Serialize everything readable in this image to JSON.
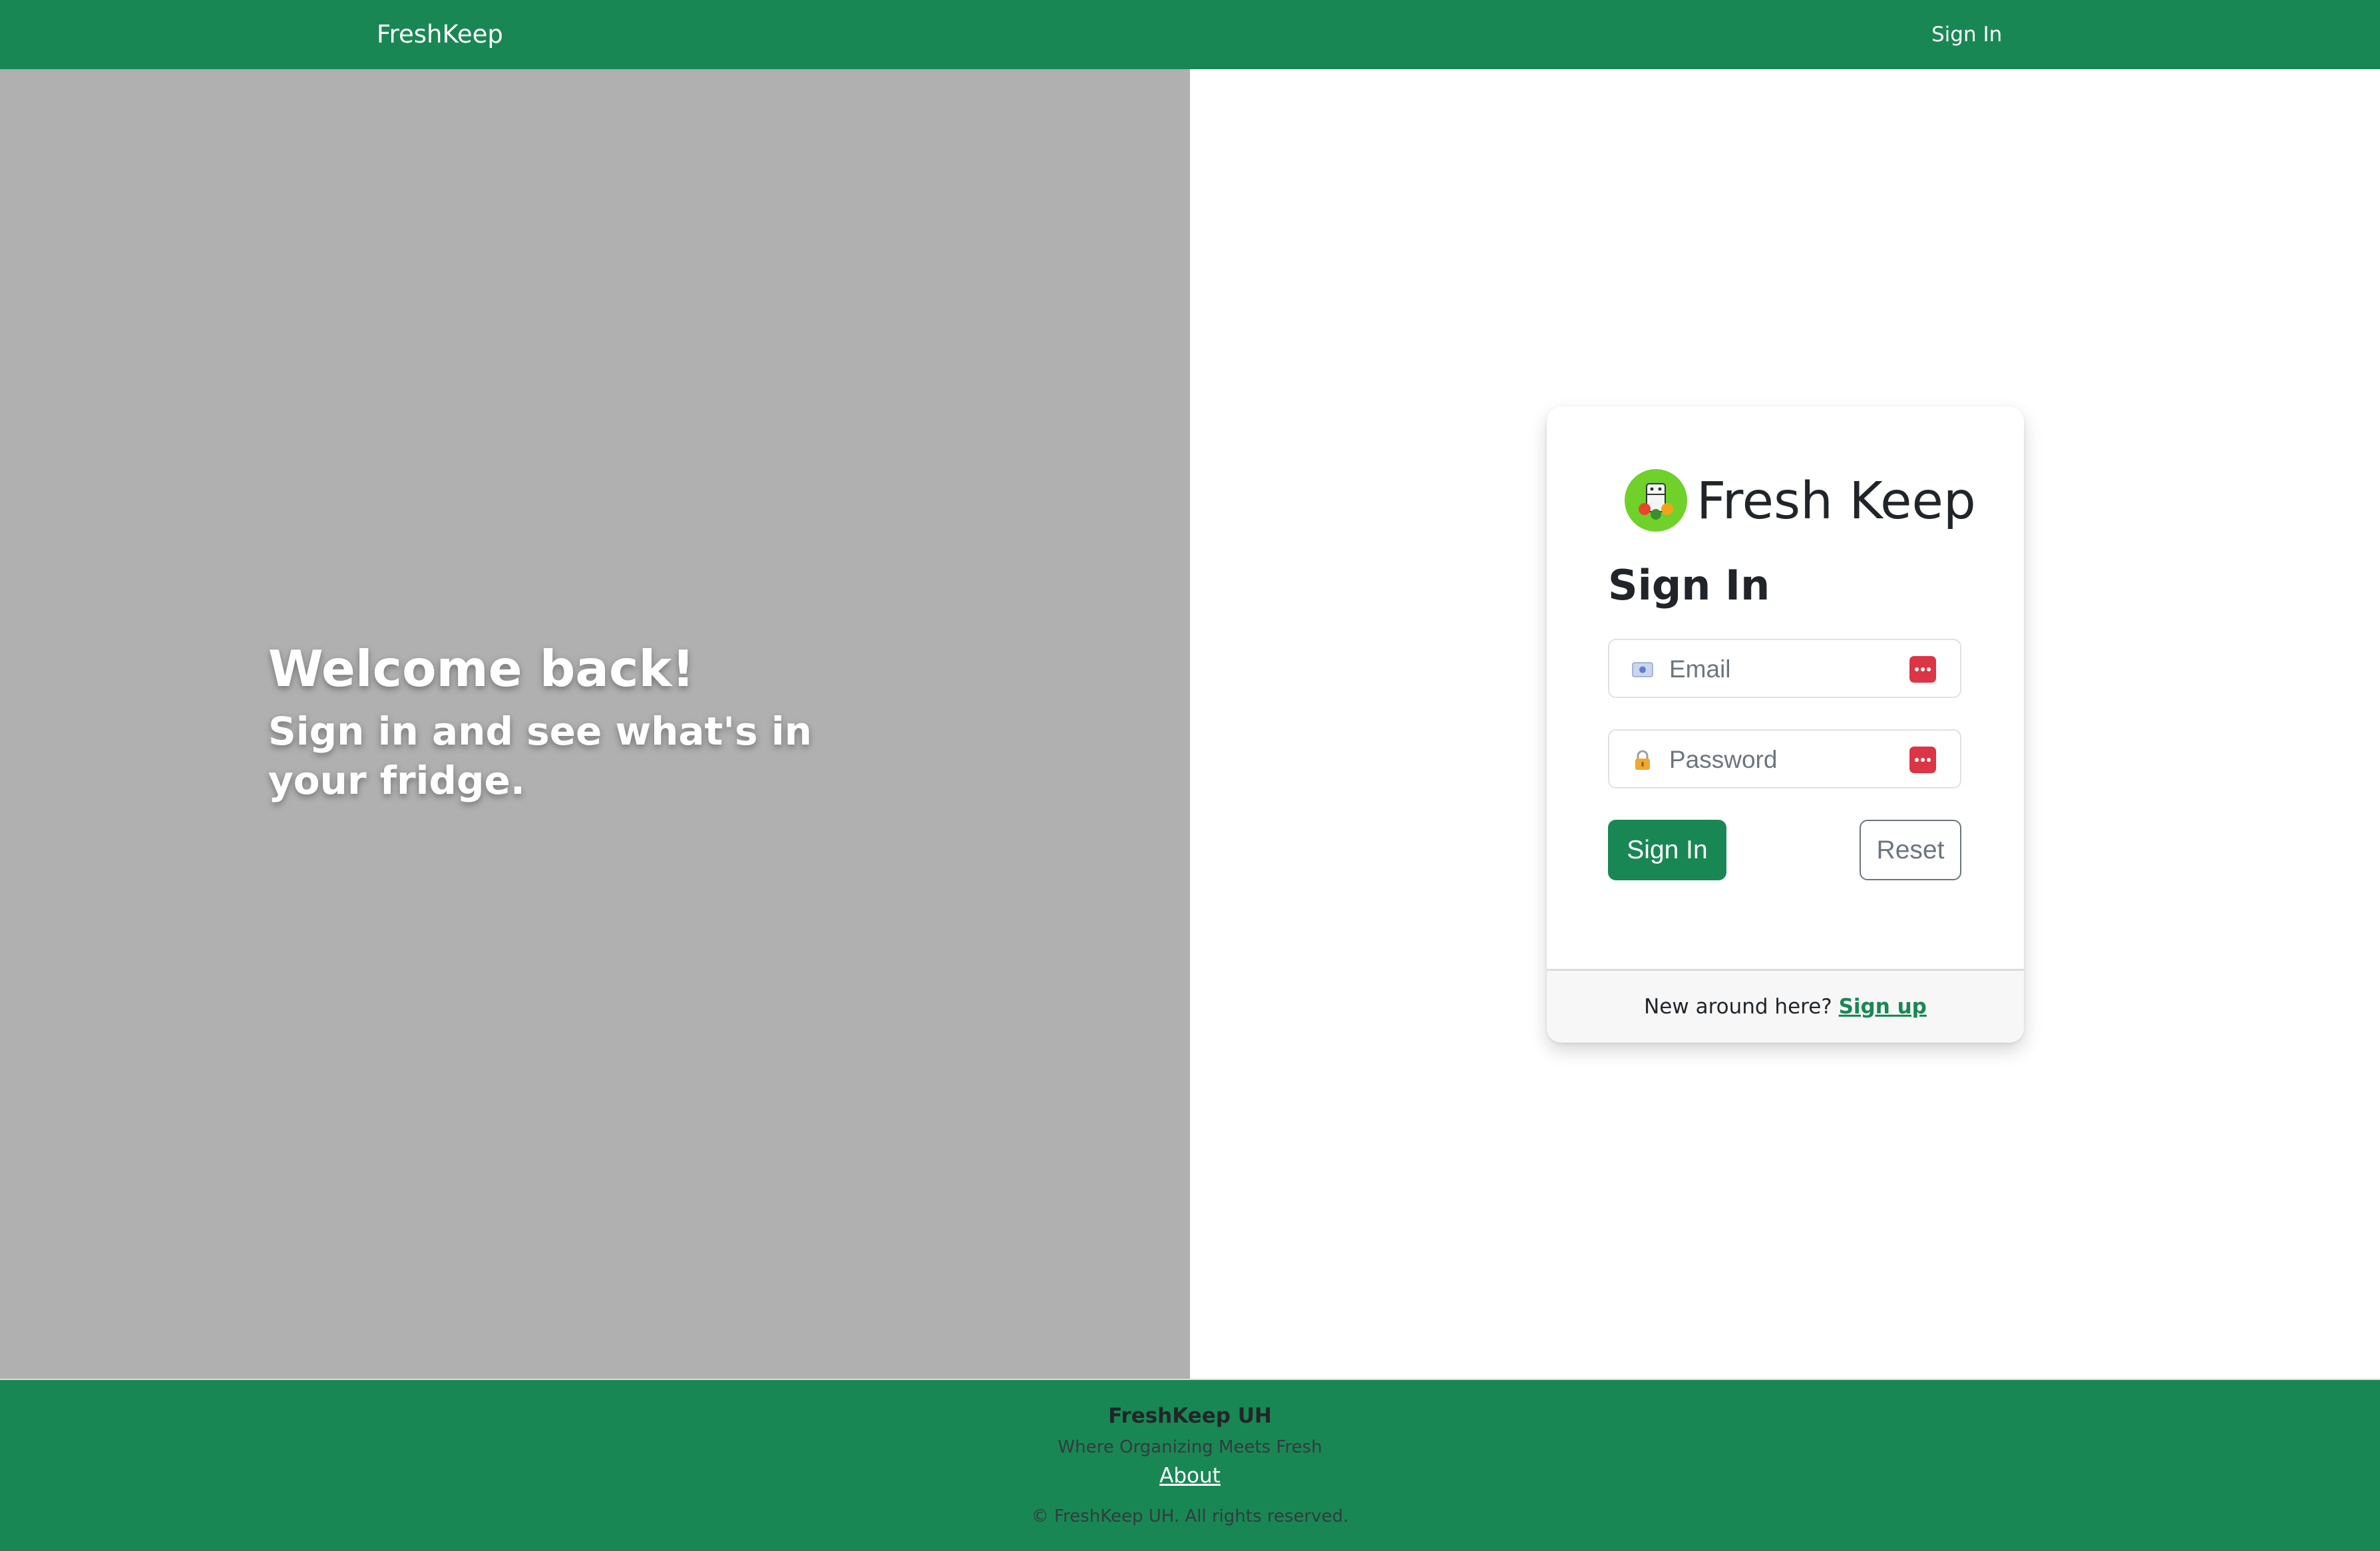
{
  "navbar": {
    "brand": "FreshKeep",
    "sign_in": "Sign In"
  },
  "hero": {
    "title": "Welcome back!",
    "subtitle": "Sign in and see what's in your fridge."
  },
  "card": {
    "app_name": "Fresh Keep",
    "title": "Sign In",
    "email": {
      "placeholder": "Email",
      "value": ""
    },
    "password": {
      "placeholder": "Password",
      "value": ""
    },
    "sign_in_button": "Sign In",
    "reset_button": "Reset",
    "footer_prompt": "New around here?",
    "signup_link": "Sign up"
  },
  "footer": {
    "name": "FreshKeep UH",
    "tagline": "Where Organizing Meets Fresh",
    "about": "About",
    "copyright": "© FreshKeep UH. All rights reserved."
  },
  "colors": {
    "brand_green": "#198754",
    "hero_gray": "#b0b0b0",
    "danger_red": "#dc3545",
    "logo_green": "#6fd12a"
  },
  "icons": {
    "email": "envelope-icon",
    "password": "lock-icon",
    "password_manager": "password-manager-icon",
    "logo": "fridge-logo-icon"
  }
}
